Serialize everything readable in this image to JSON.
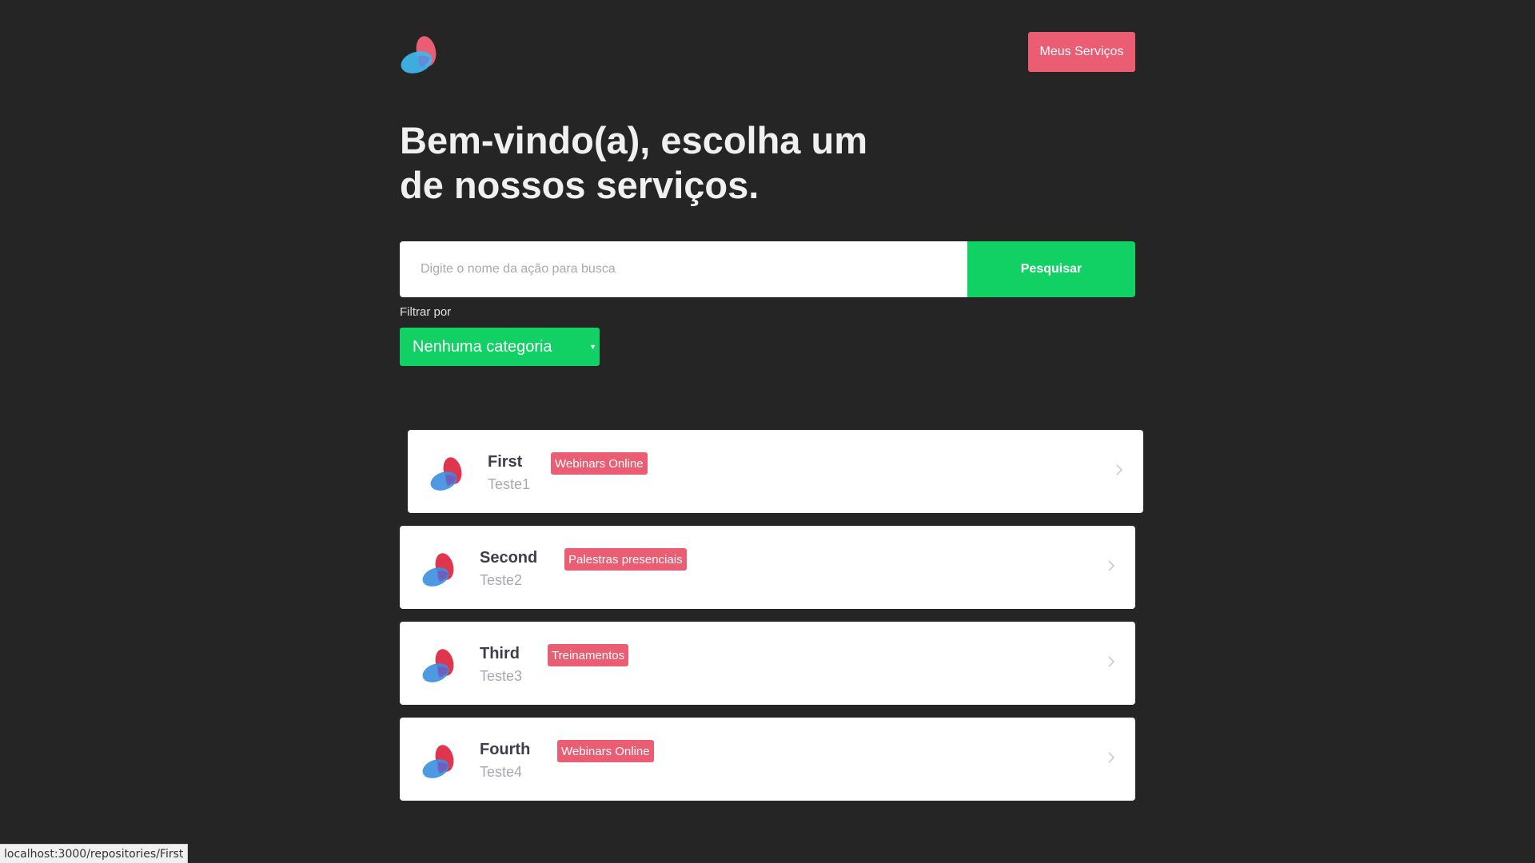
{
  "header": {
    "logo_icon": "overlapping-blobs-logo",
    "my_services_label": "Meus Serviços"
  },
  "hero": {
    "title_line1": "Bem-vindo(a), escolha um",
    "title_line2": "de nossos serviços."
  },
  "search": {
    "placeholder": "Digite o nome da ação para busca",
    "value": "",
    "button_label": "Pesquisar"
  },
  "filter": {
    "label": "Filtrar por",
    "selected": "Nenhuma categoria"
  },
  "repositories": [
    {
      "title": "First",
      "subtitle": "Teste1",
      "tag": "Webinars Online"
    },
    {
      "title": "Second",
      "subtitle": "Teste2",
      "tag": "Palestras presenciais"
    },
    {
      "title": "Third",
      "subtitle": "Teste3",
      "tag": "Treinamentos"
    },
    {
      "title": "Fourth",
      "subtitle": "Teste4",
      "tag": "Webinars Online"
    }
  ],
  "status_bar": {
    "url": "localhost:3000/repositories/First"
  },
  "colors": {
    "background": "#252525",
    "accent_pink": "#ea5d73",
    "accent_green": "#12d164",
    "card_background": "#ffffff",
    "title_text": "#3d3d4d",
    "muted_text": "#a8a8b3"
  }
}
